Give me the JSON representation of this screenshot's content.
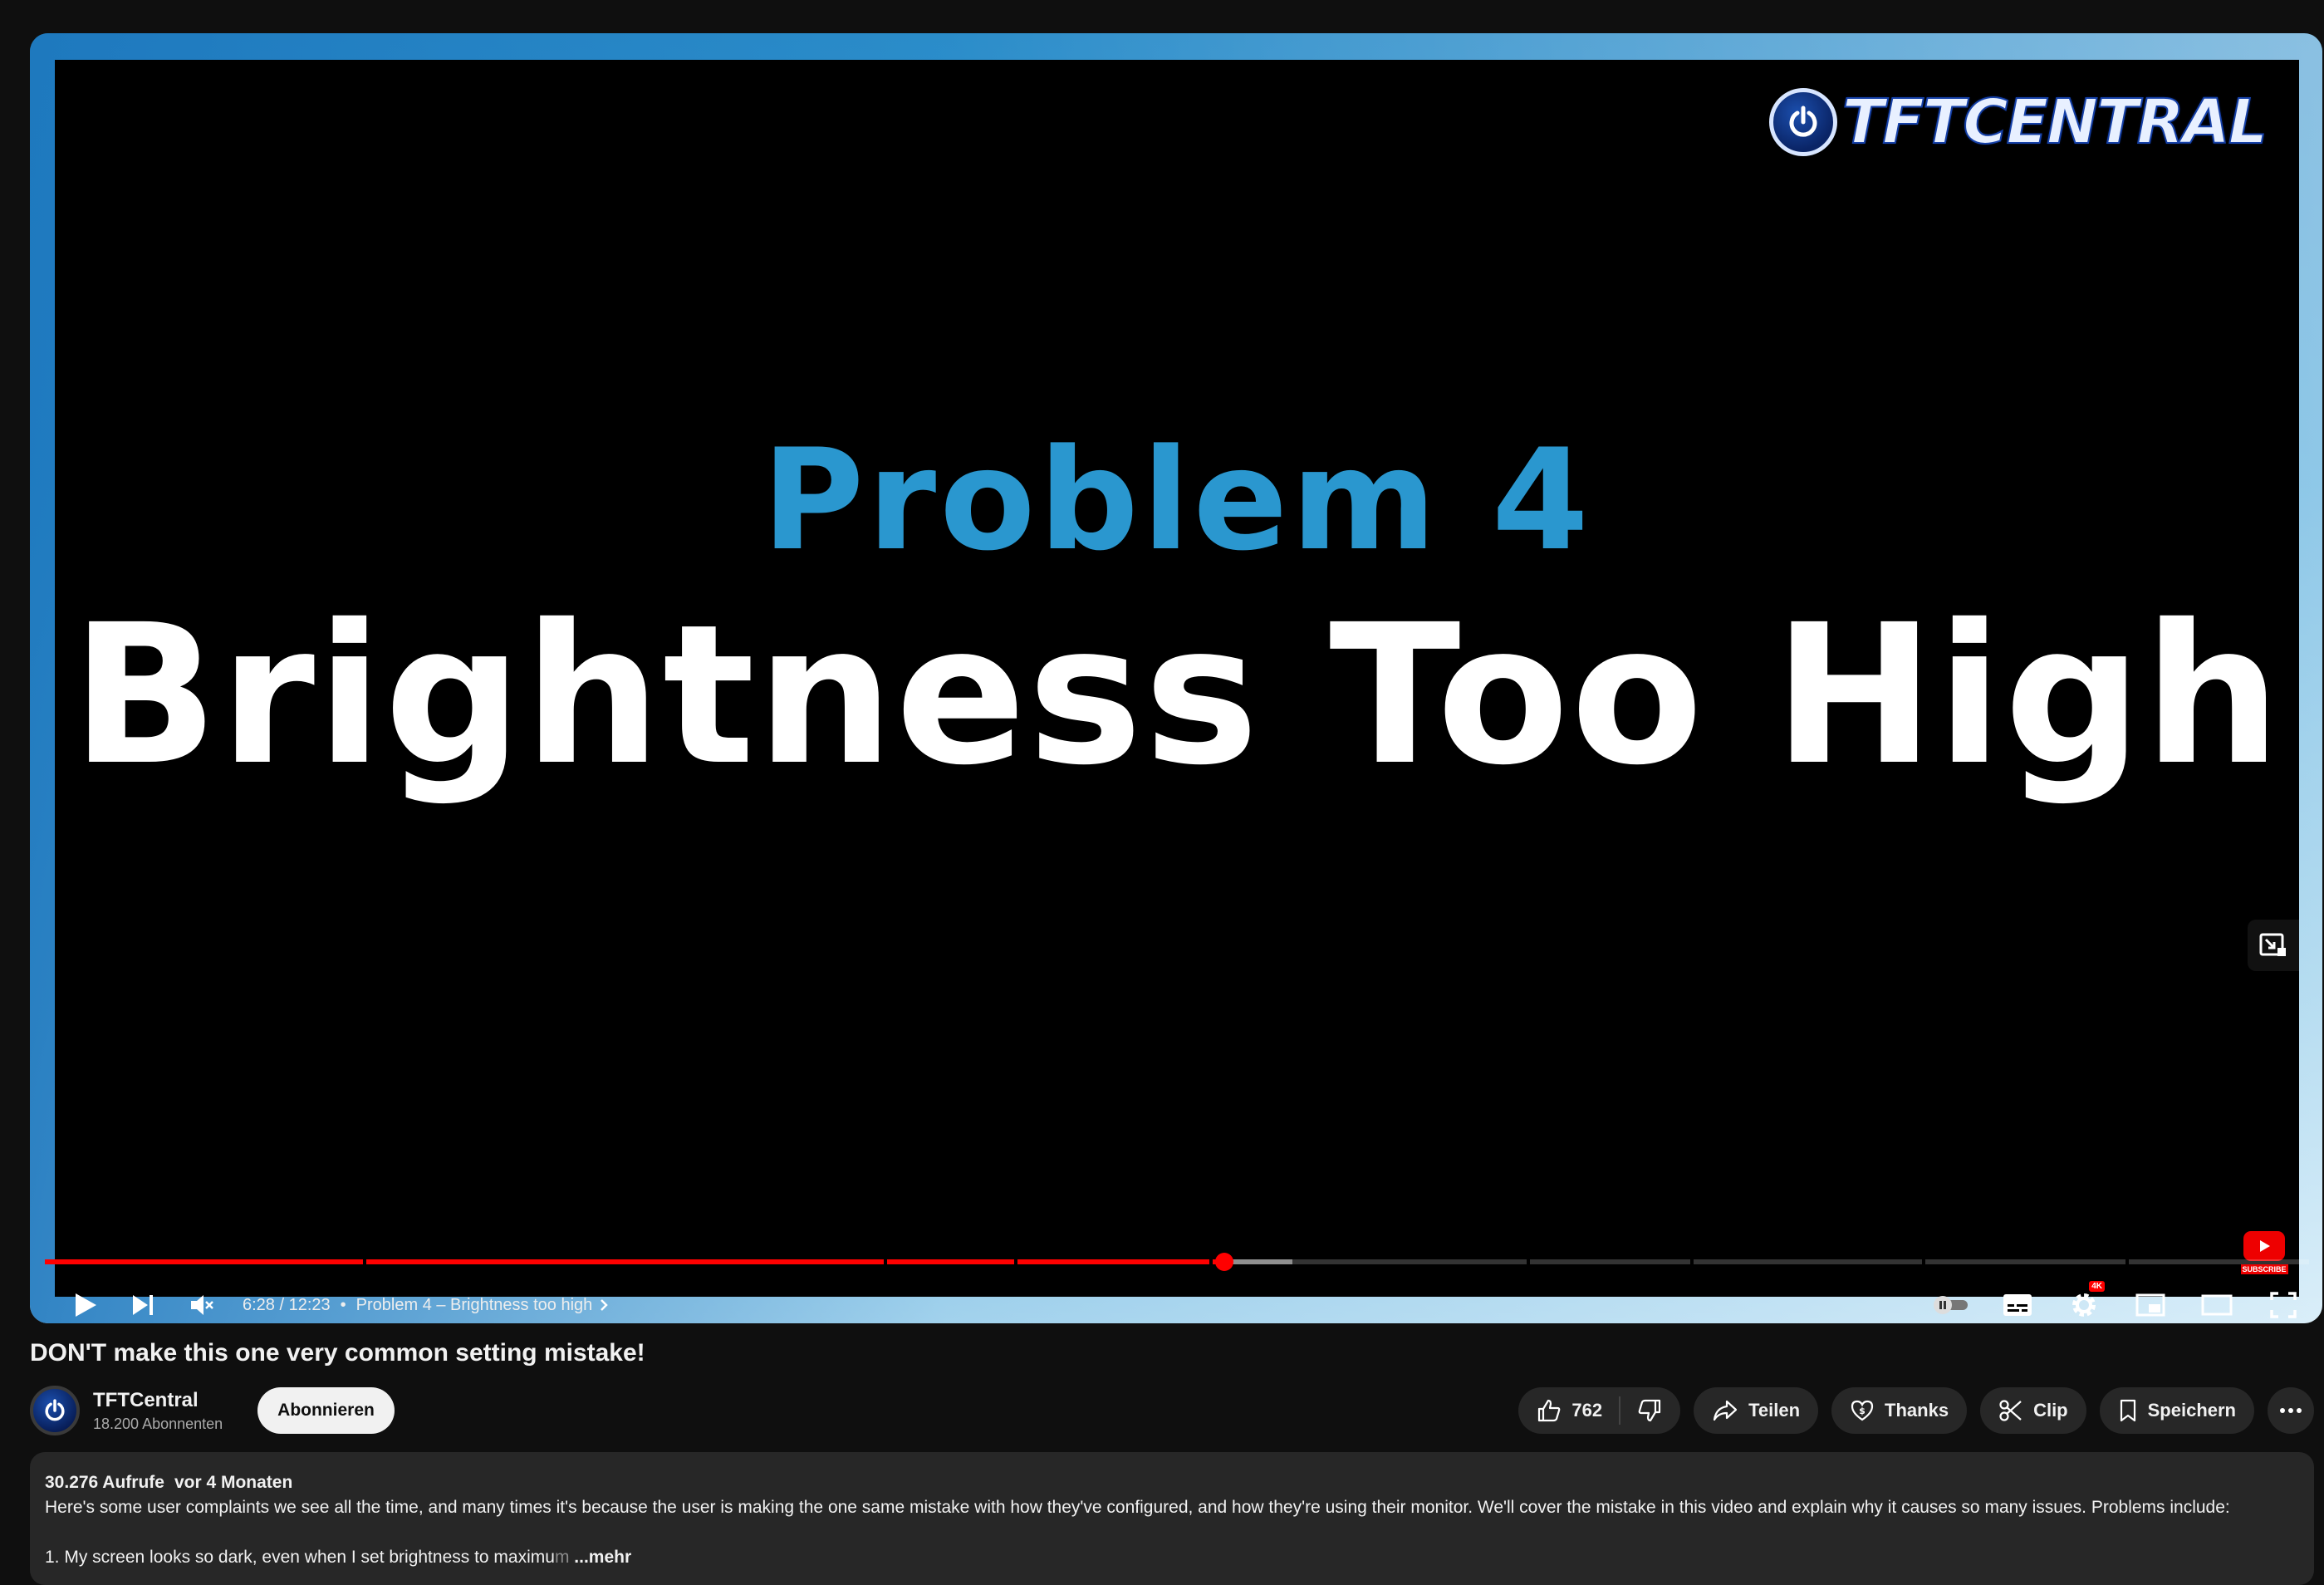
{
  "video": {
    "slide_subtitle": "Problem 4",
    "slide_title": "Brightness Too High",
    "logo_text": "TFTCENTRAL",
    "watermark_label": "SUBSCRIBE",
    "progress": {
      "played_fraction": 0.521,
      "buffered_fraction": 0.551
    },
    "time_display": "6:28 / 12:23",
    "chapter": "Problem 4 – Brightness too high",
    "settings_badge": "4K"
  },
  "title": "DON'T make this one very common setting mistake!",
  "channel": {
    "name": "TFTCentral",
    "subscribers": "18.200 Abonnenten",
    "subscribe_label": "Abonnieren"
  },
  "actions": {
    "like_count": "762",
    "share_label": "Teilen",
    "thanks_label": "Thanks",
    "clip_label": "Clip",
    "save_label": "Speichern"
  },
  "description": {
    "views": "30.276 Aufrufe",
    "age": "vor 4 Monaten",
    "line1": "Here's some user complaints we see all the time, and many times it's because the user is making the one same mistake with how they've configured, and how they're using their monitor. We'll cover the mistake in this video and explain why it causes so many issues. Problems include:",
    "line2_main": "1. My screen looks so dark, even when I set brightness to maximu",
    "line2_fade": "m",
    "more_label": "...mehr"
  },
  "colors": {
    "accent_red": "#ff0000",
    "slide_blue": "#2a97cf",
    "background": "#0f0f0f",
    "pill": "#272727"
  }
}
